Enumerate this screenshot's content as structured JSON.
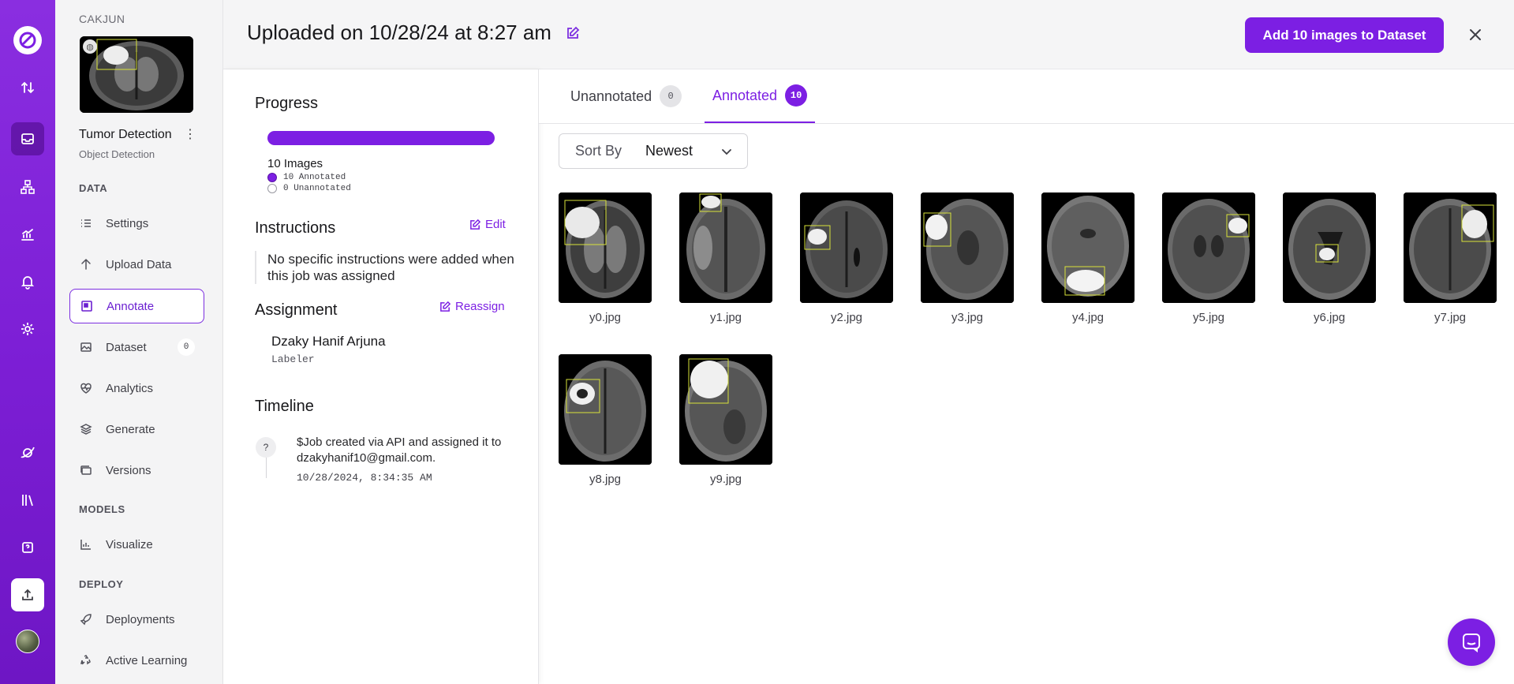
{
  "sidebar": {
    "workspace": "CAKJUN",
    "project_title": "Tumor Detection",
    "project_type": "Object Detection",
    "sections": {
      "data": "DATA",
      "models": "MODELS",
      "deploy": "DEPLOY"
    },
    "items": [
      {
        "label": "Settings",
        "icon": "list-icon"
      },
      {
        "label": "Upload Data",
        "icon": "arrow-up-icon"
      },
      {
        "label": "Annotate",
        "icon": "annotate-icon",
        "active": true
      },
      {
        "label": "Dataset",
        "icon": "image-icon",
        "count": "0"
      },
      {
        "label": "Analytics",
        "icon": "heart-pulse-icon"
      },
      {
        "label": "Generate",
        "icon": "layers-icon"
      },
      {
        "label": "Versions",
        "icon": "versions-icon"
      },
      {
        "label": "Visualize",
        "icon": "chart-icon"
      },
      {
        "label": "Deployments",
        "icon": "rocket-icon"
      },
      {
        "label": "Active Learning",
        "icon": "recycle-icon"
      }
    ]
  },
  "header": {
    "title": "Uploaded on 10/28/24 at 8:27 am",
    "add_button": "Add 10 images to Dataset"
  },
  "info": {
    "progress_heading": "Progress",
    "progress_fraction": 1.0,
    "images_count": "10 Images",
    "annotated_legend": "10 Annotated",
    "unannotated_legend": "0 Unannotated",
    "instructions_heading": "Instructions",
    "edit_label": "Edit",
    "instructions_text": "No specific instructions were added when this job was assigned",
    "assignment_heading": "Assignment",
    "reassign_label": "Reassign",
    "assignee_name": "Dzaky Hanif Arjuna",
    "assignee_role": "Labeler",
    "timeline_heading": "Timeline",
    "timeline_icon": "?",
    "timeline_text": "$Job created via API and assigned it to dzakyhanif10@gmail.com.",
    "timeline_time": "10/28/2024, 8:34:35 AM"
  },
  "tabs": {
    "unannotated_label": "Unannotated",
    "unannotated_count": "0",
    "annotated_label": "Annotated",
    "annotated_count": "10"
  },
  "sort": {
    "label": "Sort By",
    "value": "Newest"
  },
  "images": [
    {
      "name": "y0.jpg"
    },
    {
      "name": "y1.jpg"
    },
    {
      "name": "y2.jpg"
    },
    {
      "name": "y3.jpg"
    },
    {
      "name": "y4.jpg"
    },
    {
      "name": "y5.jpg"
    },
    {
      "name": "y6.jpg"
    },
    {
      "name": "y7.jpg"
    },
    {
      "name": "y8.jpg"
    },
    {
      "name": "y9.jpg"
    }
  ],
  "colors": {
    "accent": "#7c1fe3",
    "annotation_box": "#d8e23a"
  }
}
